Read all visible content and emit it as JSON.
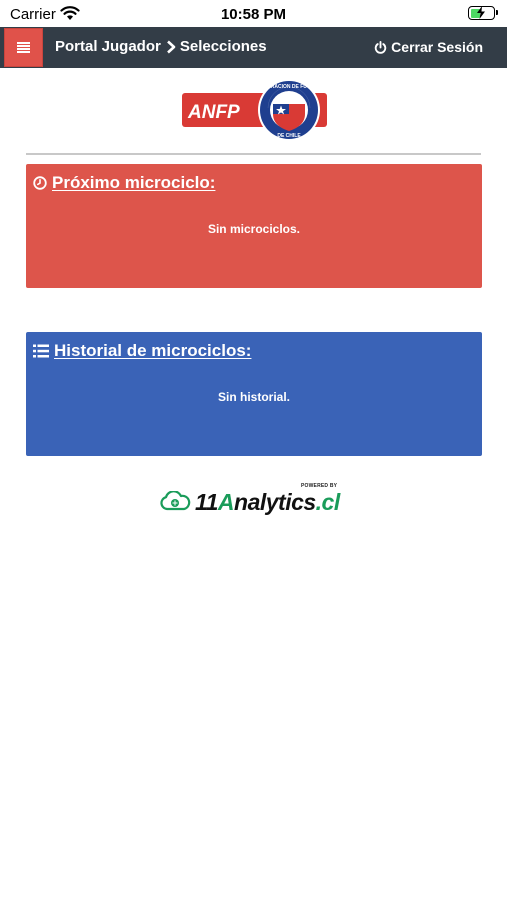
{
  "status_bar": {
    "carrier": "Carrier",
    "time": "10:58 PM"
  },
  "navbar": {
    "crumb_1": "Portal Jugador",
    "crumb_2": "Selecciones",
    "logout_label": "Cerrar Sesión"
  },
  "logo": {
    "text": "ANFP",
    "seal_top": "FEDERACION DE FUTBOL",
    "seal_bottom": "DE CHILE"
  },
  "panels": {
    "next": {
      "title": "Próximo microciclo:",
      "body": "Sin microciclos."
    },
    "history": {
      "title": "Historial de microciclos:",
      "body": "Sin historial."
    }
  },
  "footer": {
    "powered_by": "POWERED BY",
    "brand_number": "11",
    "brand_accent": "A",
    "brand_rest": "nalytics",
    "brand_tld": ".cl"
  },
  "colors": {
    "navbar": "#333d47",
    "menu_button": "#e0524a",
    "panel_red": "#dd554b",
    "panel_blue": "#3a63b7",
    "brand_green": "#1a9c5a"
  }
}
